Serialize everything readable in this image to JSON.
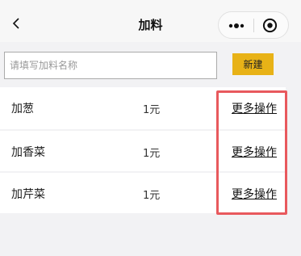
{
  "nav": {
    "title": "加料"
  },
  "icons": {
    "back": "chevron-left-icon",
    "more": "more-dots-icon",
    "close": "target-circle-icon"
  },
  "form": {
    "placeholder": "请填写加料名称",
    "value": "",
    "create_label": "新建"
  },
  "items": [
    {
      "name": "加葱",
      "price": "1元",
      "action": "更多操作"
    },
    {
      "name": "加香菜",
      "price": "1元",
      "action": "更多操作"
    },
    {
      "name": "加芹菜",
      "price": "1元",
      "action": "更多操作"
    }
  ],
  "colors": {
    "accent": "#e8b217",
    "highlight": "#e8595d"
  }
}
